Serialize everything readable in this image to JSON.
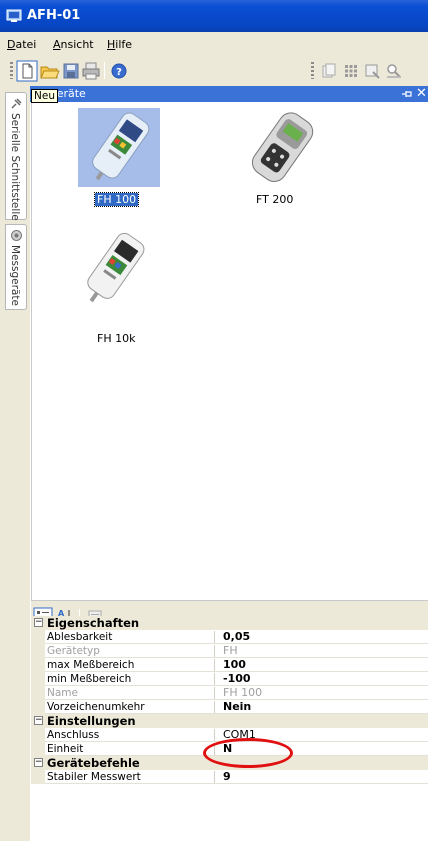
{
  "window": {
    "title": "AFH-01"
  },
  "menu": [
    {
      "label": "Datei"
    },
    {
      "label": "Ansicht"
    },
    {
      "label": "Hilfe"
    }
  ],
  "toolbar": {
    "tooltip": "Neu",
    "buttons": [
      "new-icon",
      "open-folder-icon",
      "save-icon",
      "print-icon",
      "help-icon"
    ],
    "right_buttons": [
      "copy-icon",
      "grid-icon",
      "select-icon",
      "zoom-icon"
    ]
  },
  "side_tabs": [
    {
      "label": "Serielle Schnittstelle",
      "icon": "plug-icon"
    },
    {
      "label": "Messgeräte",
      "icon": "device-icon"
    }
  ],
  "panel": {
    "title": "Messgeräte",
    "title_visible": "sgeräte"
  },
  "devices": [
    {
      "label": "FH 100",
      "selected": true
    },
    {
      "label": "FT 200",
      "selected": false
    },
    {
      "label": "FH 10k",
      "selected": false
    }
  ],
  "properties": {
    "categories": [
      {
        "label": "Eigenschaften",
        "items": [
          {
            "name": "Ablesbarkeit",
            "value": "0,05",
            "disabled": false
          },
          {
            "name": "Gerätetyp",
            "value": "FH",
            "disabled": true
          },
          {
            "name": "max Meßbereich",
            "value": "100",
            "disabled": false
          },
          {
            "name": "min Meßbereich",
            "value": "-100",
            "disabled": false
          },
          {
            "name": "Name",
            "value": "FH 100",
            "disabled": true
          },
          {
            "name": "Vorzeichenumkehr",
            "value": "Nein",
            "disabled": false
          }
        ]
      },
      {
        "label": "Einstellungen",
        "items": [
          {
            "name": "Anschluss",
            "value": "COM1",
            "disabled": false,
            "normal": true
          },
          {
            "name": "Einheit",
            "value": "N",
            "disabled": false
          }
        ]
      },
      {
        "label": "Gerätebefehle",
        "items": [
          {
            "name": "Stabiler Messwert",
            "value": "9",
            "disabled": false
          }
        ]
      }
    ],
    "toggle_symbol": "⊟"
  },
  "colors": {
    "title_bar": "#0a4fd4",
    "panel_header": "#3b72d8",
    "selection": "#316ac5",
    "highlight_circle": "#e01010"
  }
}
